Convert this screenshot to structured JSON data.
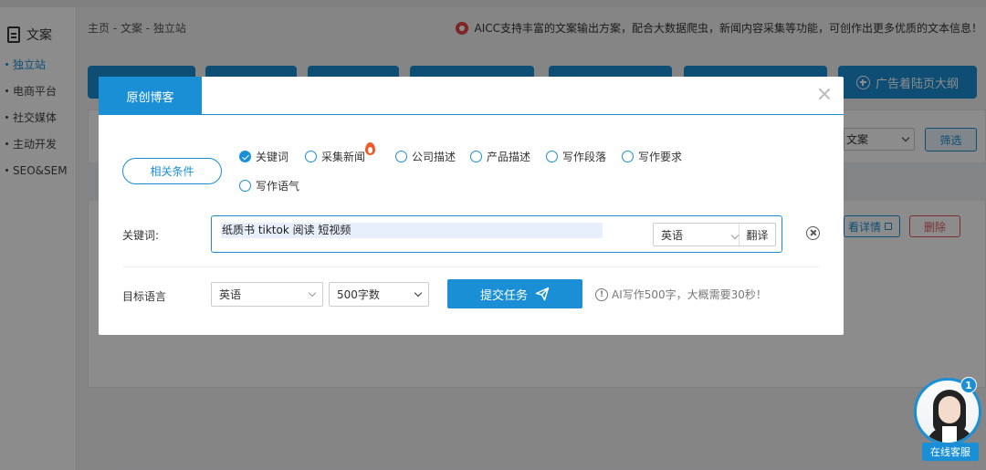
{
  "sidebar": {
    "section_title": "文案",
    "items": [
      {
        "label": "独立站",
        "active": true
      },
      {
        "label": "电商平台",
        "active": false
      },
      {
        "label": "社交媒体",
        "active": false
      },
      {
        "label": "主动开发",
        "active": false
      },
      {
        "label": "SEO&SEM",
        "active": false
      }
    ]
  },
  "header": {
    "breadcrumb": "主页 - 文案 - 独立站",
    "notice": "AICC支持丰富的文案输出方案，配合大数据爬虫，新闻内容采集等功能，可创作出更多优质的文本信息！"
  },
  "background": {
    "last_tab_label": "广告着陆页大纲",
    "select_value": "文案",
    "filter_label": "筛选",
    "detail_label": "看详情",
    "delete_label": "删除"
  },
  "modal": {
    "tab_title": "原创博客",
    "condition_button": "相关条件",
    "options": [
      {
        "label": "关键词",
        "checked": true
      },
      {
        "label": "采集新闻",
        "checked": false,
        "hot": true
      },
      {
        "label": "公司描述",
        "checked": false
      },
      {
        "label": "产品描述",
        "checked": false
      },
      {
        "label": "写作段落",
        "checked": false
      },
      {
        "label": "写作要求",
        "checked": false
      },
      {
        "label": "写作语气",
        "checked": false
      }
    ],
    "keyword_label": "关键词:",
    "keyword_value": "纸质书 tiktok 阅读 短视频",
    "keyword_lang": "英语",
    "translate_label": "翻译",
    "target_lang_label": "目标语言",
    "target_lang_value": "英语",
    "word_count_value": "500字数",
    "submit_label": "提交任务",
    "hint": "AI写作500字，大概需要30秒！"
  },
  "support": {
    "label": "在线客服",
    "badge_count": "1"
  },
  "colors": {
    "accent": "#1a8fd6",
    "danger": "#e05a5a",
    "hot": "#f05a28"
  }
}
